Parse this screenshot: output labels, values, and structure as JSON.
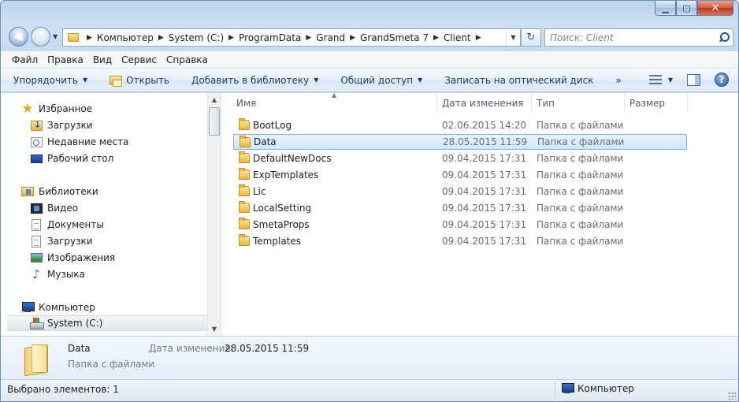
{
  "window": {
    "caption_buttons": {
      "minimize": "▁",
      "maximize": "▢",
      "close": "✕"
    }
  },
  "nav": {
    "back_glyph": "◀",
    "forward_glyph": "▶",
    "dropdown_glyph": "▼"
  },
  "address": {
    "crumbs": [
      "Компьютер",
      "System (C:)",
      "ProgramData",
      "Grand",
      "GrandSmeta 7",
      "Client"
    ],
    "separator": "▶",
    "dropdown_glyph": "▼"
  },
  "refresh_glyph": "↻",
  "search": {
    "placeholder": "Поиск: Client"
  },
  "menu": [
    "Файл",
    "Правка",
    "Вид",
    "Сервис",
    "Справка"
  ],
  "commands": {
    "organize": "Упорядочить",
    "open": "Открыть",
    "add_to_library": "Добавить в библиотеку",
    "share": "Общий доступ",
    "burn": "Записать на оптический диск",
    "more": "»",
    "dropdown_glyph": "▼",
    "help": "?"
  },
  "nav_pane": {
    "favorites": {
      "title": "Избранное",
      "items": [
        "Загрузки",
        "Недавние места",
        "Рабочий стол"
      ]
    },
    "libraries": {
      "title": "Библиотеки",
      "items": [
        "Видео",
        "Документы",
        "Загрузки",
        "Изображения",
        "Музыка"
      ]
    },
    "computer": {
      "title": "Компьютер",
      "items": [
        "System (C:)"
      ]
    },
    "scroll_up": "▲",
    "scroll_down": "▼"
  },
  "columns": {
    "name": "Имя",
    "date": "Дата изменения",
    "type": "Тип",
    "size": "Размер",
    "sort_glyph": "▲"
  },
  "files": [
    {
      "name": "BootLog",
      "date": "02.06.2015 14:20",
      "type": "Папка с файлами"
    },
    {
      "name": "Data",
      "date": "28.05.2015 11:59",
      "type": "Папка с файлами",
      "selected": true
    },
    {
      "name": "DefaultNewDocs",
      "date": "09.04.2015 17:31",
      "type": "Папка с файлами"
    },
    {
      "name": "ExpTemplates",
      "date": "09.04.2015 17:31",
      "type": "Папка с файлами"
    },
    {
      "name": "Lic",
      "date": "09.04.2015 17:31",
      "type": "Папка с файлами"
    },
    {
      "name": "LocalSetting",
      "date": "09.04.2015 17:31",
      "type": "Папка с файлами"
    },
    {
      "name": "SmetaProps",
      "date": "09.04.2015 17:31",
      "type": "Папка с файлами"
    },
    {
      "name": "Templates",
      "date": "09.04.2015 17:31",
      "type": "Папка с файлами"
    }
  ],
  "details": {
    "name": "Data",
    "type": "Папка с файлами",
    "modified_label": "Дата изменения:",
    "modified_value": "28.05.2015 11:59"
  },
  "status": {
    "selected": "Выбрано элементов: 1",
    "location": "Компьютер"
  }
}
